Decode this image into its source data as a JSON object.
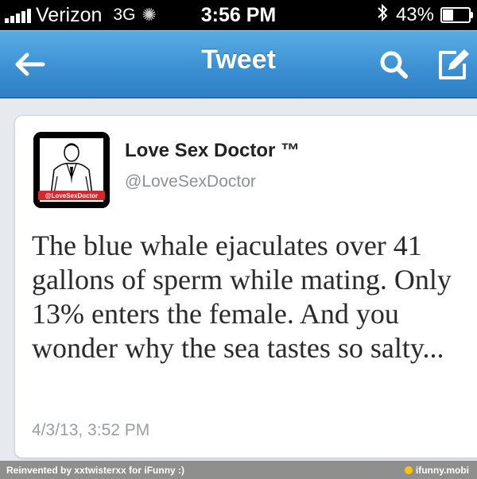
{
  "status_bar": {
    "carrier": "Verizon",
    "network": "3G",
    "time": "3:56 PM",
    "battery_percent": "43%",
    "battery_level": 0.43,
    "signal_bars": 5,
    "icons": [
      "signal-icon",
      "activity-spinner-icon",
      "bluetooth-icon",
      "battery-icon"
    ]
  },
  "nav": {
    "title": "Tweet",
    "icons": [
      "back-arrow-icon",
      "search-icon",
      "compose-icon"
    ]
  },
  "tweet": {
    "display_name": "Love Sex Doctor ™",
    "handle": "@LoveSexDoctor",
    "avatar_badge": "@LoveSexDoctor",
    "text": "The blue whale ejaculates over 41 gallons of sperm while mating. Only 13% enters the female. And you wonder why the sea tastes so salty...",
    "timestamp": "4/3/13, 3:52 PM"
  },
  "footer": {
    "credit": "Reinvented by xxtwisterxx for iFunny :)",
    "site": "ifunny.mobi"
  },
  "colors": {
    "nav_blue": "#3a8fd2",
    "text_gray": "#8d9196",
    "avatar_red": "#d6262e"
  }
}
